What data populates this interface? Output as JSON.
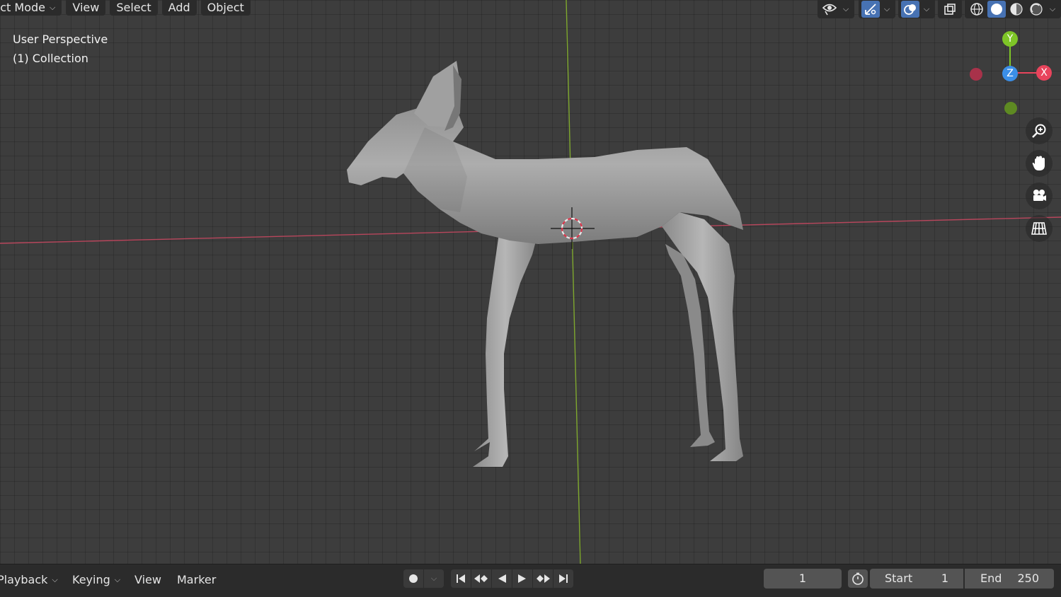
{
  "header": {
    "mode_label": "Object Mode",
    "menus": [
      "View",
      "Select",
      "Add",
      "Object"
    ]
  },
  "viewport": {
    "view_name": "User Perspective",
    "collection": "(1) Collection"
  },
  "gizmo": {
    "y": "Y",
    "x": "X",
    "z": "Z"
  },
  "timeline": {
    "playback": "Playback",
    "keying": "Keying",
    "view": "View",
    "marker": "Marker",
    "current_frame": "1",
    "start_label": "Start",
    "start_value": "1",
    "end_label": "End",
    "end_value": "250"
  },
  "colors": {
    "x_axis": "#e8445c",
    "y_axis": "#7ec527",
    "z_axis": "#3b8fe8",
    "accent": "#4772b3"
  }
}
